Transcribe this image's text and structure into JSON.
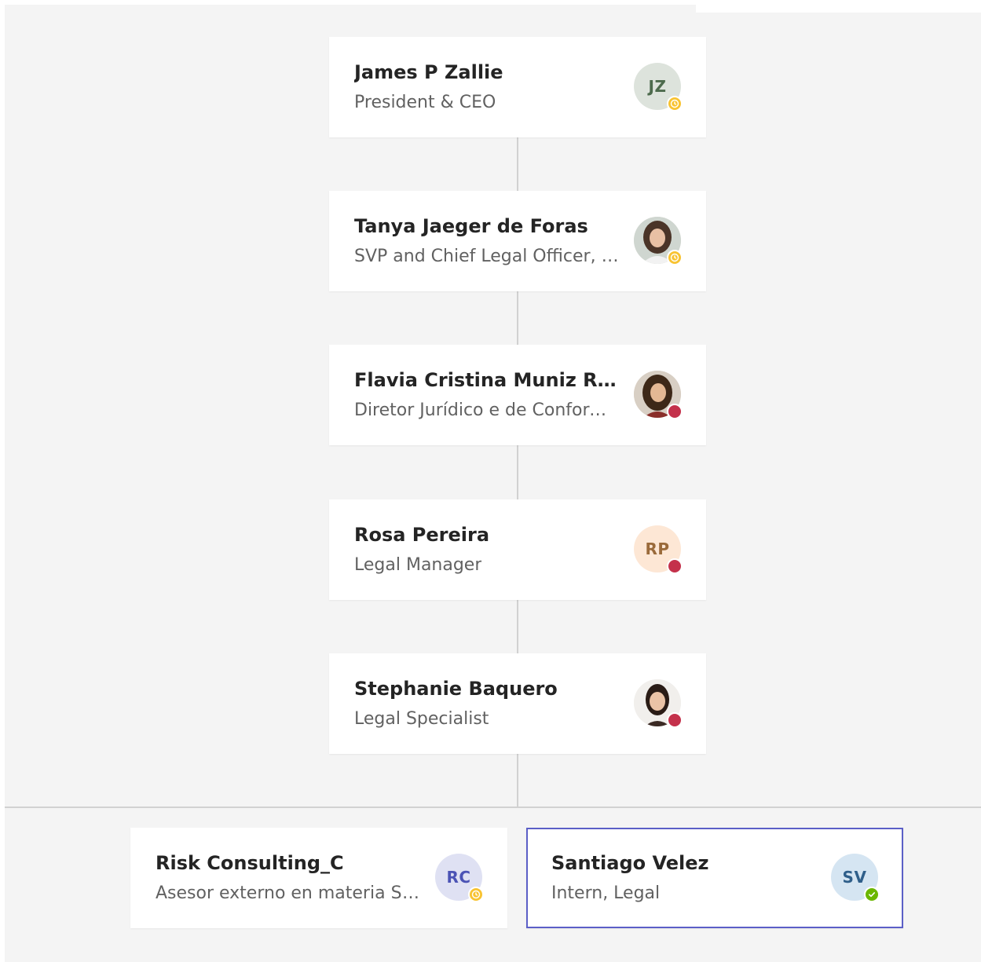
{
  "colors": {
    "canvas_bg": "#f4f4f4",
    "card_bg": "#ffffff",
    "connector": "#d1d1d1",
    "selected_border": "#5b5fc7",
    "away": "#f8c331",
    "busy": "#c4314b",
    "available": "#6bb700"
  },
  "chain": [
    {
      "name": "James P Zallie",
      "title": "President & CEO",
      "initials": "JZ",
      "avatar_bg": "#dde3dc",
      "initials_color": "#4d6b4d",
      "presence": "away",
      "photo": false
    },
    {
      "name": "Tanya Jaeger de Foras",
      "title": "SVP and Chief Legal Officer, C...",
      "initials": "",
      "presence": "away",
      "photo": true
    },
    {
      "name": "Flavia Cristina Muniz Ri...",
      "title": "Diretor Jurídico e de Conform...",
      "initials": "",
      "presence": "busy",
      "photo": true
    },
    {
      "name": "Rosa Pereira",
      "title": "Legal Manager",
      "initials": "RP",
      "avatar_bg": "#fde7d5",
      "initials_color": "#9a6a3a",
      "presence": "busy",
      "photo": false
    },
    {
      "name": "Stephanie Baquero",
      "title": "Legal Specialist",
      "initials": "",
      "presence": "busy",
      "photo": true
    }
  ],
  "reports": [
    {
      "name": "Risk Consulting_C",
      "title": "Asesor externo en materia SA...",
      "initials": "RC",
      "avatar_bg": "#dfe1f3",
      "initials_color": "#4b53b5",
      "presence": "away",
      "selected": false
    },
    {
      "name": "Santiago Velez",
      "title": "Intern, Legal",
      "initials": "SV",
      "avatar_bg": "#d5e5f2",
      "initials_color": "#2f5f8a",
      "presence": "available",
      "selected": true
    }
  ]
}
